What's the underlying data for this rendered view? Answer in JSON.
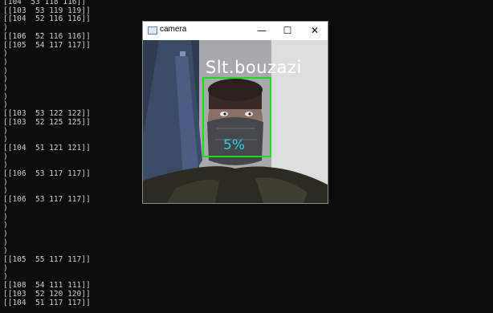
{
  "console": {
    "lines": [
      {
        "row": 0,
        "text": "[104  53 118 116]]"
      },
      {
        "row": 1,
        "text": "[[103  53 119 119]]"
      },
      {
        "row": 2,
        "text": "[[104  52 116 116]]"
      },
      {
        "row": 3,
        "text": ")"
      },
      {
        "row": 4,
        "text": "[[106  52 116 116]]"
      },
      {
        "row": 5,
        "text": "[[105  54 117 117]]"
      },
      {
        "row": 6,
        "text": ")"
      },
      {
        "row": 7,
        "text": ")"
      },
      {
        "row": 8,
        "text": ")"
      },
      {
        "row": 9,
        "text": ")"
      },
      {
        "row": 10,
        "text": ")"
      },
      {
        "row": 11,
        "text": ")"
      },
      {
        "row": 12,
        "text": ")"
      },
      {
        "row": 13,
        "text": "[[103  53 122 122]]"
      },
      {
        "row": 14,
        "text": "[[103  52 125 125]]"
      },
      {
        "row": 15,
        "text": ")"
      },
      {
        "row": 16,
        "text": ")"
      },
      {
        "row": 17,
        "text": "[[104  51 121 121]]"
      },
      {
        "row": 18,
        "text": ")"
      },
      {
        "row": 19,
        "text": ")"
      },
      {
        "row": 20,
        "text": "[[106  53 117 117]]"
      },
      {
        "row": 21,
        "text": ")"
      },
      {
        "row": 22,
        "text": ")"
      },
      {
        "row": 23,
        "text": "[[106  53 117 117]]"
      },
      {
        "row": 24,
        "text": ")"
      },
      {
        "row": 25,
        "text": ")"
      },
      {
        "row": 26,
        "text": ")"
      },
      {
        "row": 27,
        "text": ")"
      },
      {
        "row": 28,
        "text": ")"
      },
      {
        "row": 29,
        "text": ")"
      },
      {
        "row": 30,
        "text": "[[105  55 117 117]]"
      },
      {
        "row": 31,
        "text": ")"
      },
      {
        "row": 32,
        "text": ")"
      },
      {
        "row": 33,
        "text": "[[108  54 111 111]]"
      },
      {
        "row": 34,
        "text": "[[103  52 120 120]]"
      },
      {
        "row": 35,
        "text": "[[104  51 117 117]]"
      }
    ]
  },
  "window": {
    "title": "camera",
    "minimize_glyph": "—",
    "maximize_glyph": "☐",
    "close_glyph": "✕",
    "icon": "app-window-icon"
  },
  "detection": {
    "label": "Slt.bouzazi",
    "confidence": "5%",
    "box_color": "#16e016",
    "confidence_color": "#2bd3e8"
  }
}
